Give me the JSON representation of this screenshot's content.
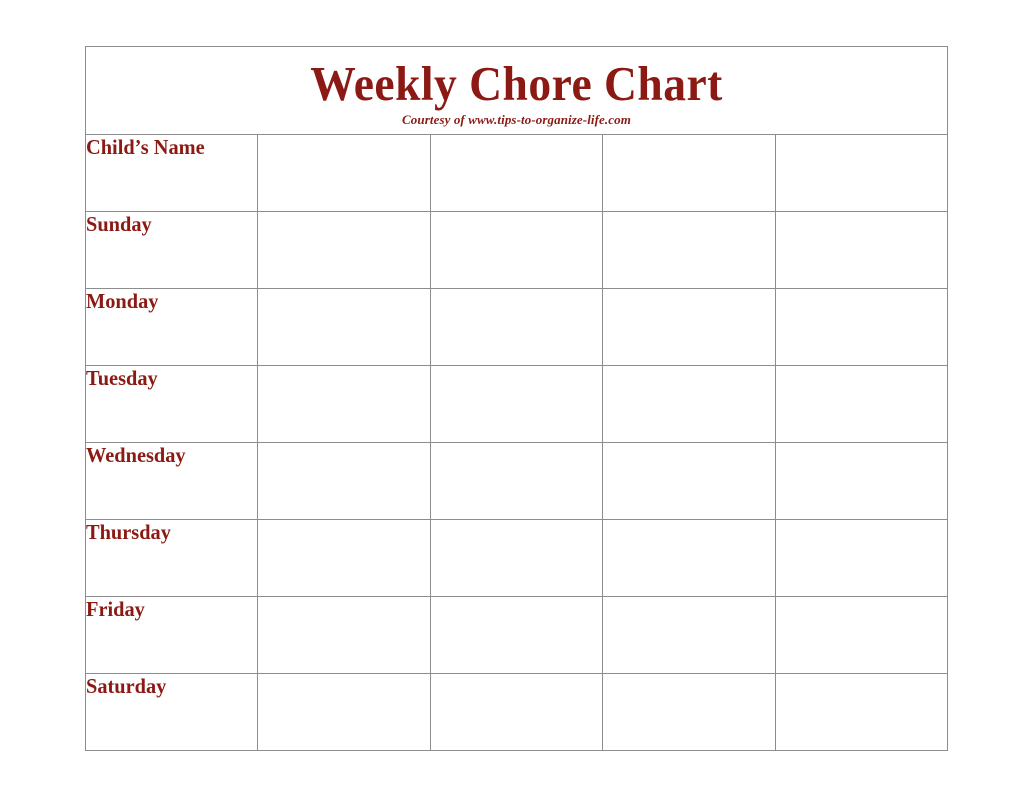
{
  "page": {
    "background_color": "#ffffff",
    "text_color": "#8b1a15",
    "border_color": "#8d8d8d"
  },
  "header": {
    "title": "Weekly Chore Chart",
    "subtitle": "Courtesy of www.tips-to-organize-life.com"
  },
  "table": {
    "label_column_header": "Child’s Name",
    "row_labels": [
      "Child’s Name",
      "Sunday",
      "Monday",
      "Tuesday",
      "Wednesday",
      "Thursday",
      "Friday",
      "Saturday"
    ],
    "entry_columns": [
      "",
      "",
      "",
      ""
    ],
    "cells": [
      [
        "",
        "",
        "",
        ""
      ],
      [
        "",
        "",
        "",
        ""
      ],
      [
        "",
        "",
        "",
        ""
      ],
      [
        "",
        "",
        "",
        ""
      ],
      [
        "",
        "",
        "",
        ""
      ],
      [
        "",
        "",
        "",
        ""
      ],
      [
        "",
        "",
        "",
        ""
      ],
      [
        "",
        "",
        "",
        ""
      ]
    ]
  }
}
